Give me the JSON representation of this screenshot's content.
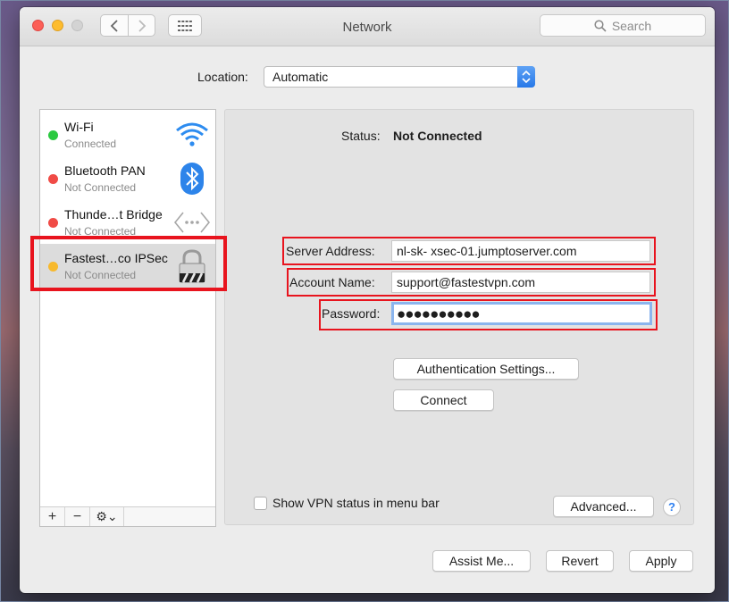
{
  "window": {
    "title": "Network"
  },
  "toolbar": {
    "back_icon": "chevron-left-icon",
    "forward_icon": "chevron-right-icon",
    "grid_icon": "grid-icon"
  },
  "search": {
    "placeholder": "Search"
  },
  "location": {
    "label": "Location:",
    "value": "Automatic"
  },
  "services": [
    {
      "name": "Wi-Fi",
      "status": "Connected",
      "dot_color": "#2bc940",
      "icon": "wifi-icon"
    },
    {
      "name": "Bluetooth PAN",
      "status": "Not Connected",
      "dot_color": "#f04b46",
      "icon": "bluetooth-icon"
    },
    {
      "name": "Thunde…t Bridge",
      "status": "Not Connected",
      "dot_color": "#f04b46",
      "icon": "thunderbolt-bridge-icon"
    },
    {
      "name": "Fastest…co IPSec",
      "status": "Not Connected",
      "dot_color": "#f7b92d",
      "icon": "vpn-lock-icon",
      "selected": true
    }
  ],
  "sidebar_toolbar": {
    "add": "+",
    "remove": "−",
    "gear": "⚙⌄"
  },
  "status": {
    "label": "Status:",
    "value": "Not Connected"
  },
  "form": {
    "server_label": "Server Address:",
    "server_value": "nl-sk- xsec-01.jumptoserver.com",
    "account_label": "Account Name:",
    "account_value": "support@fastestvpn.com",
    "password_label": "Password:",
    "password_value": "●●●●●●●●●●"
  },
  "buttons": {
    "auth_settings": "Authentication Settings...",
    "connect": "Connect",
    "advanced": "Advanced...",
    "help": "?",
    "assist": "Assist Me...",
    "revert": "Revert",
    "apply": "Apply"
  },
  "checkbox": {
    "label": "Show VPN status in menu bar",
    "checked": false
  },
  "colors": {
    "highlight_box": "#e8141e",
    "focus_ring": "#8bb5ee",
    "accent": "#2778e8"
  }
}
